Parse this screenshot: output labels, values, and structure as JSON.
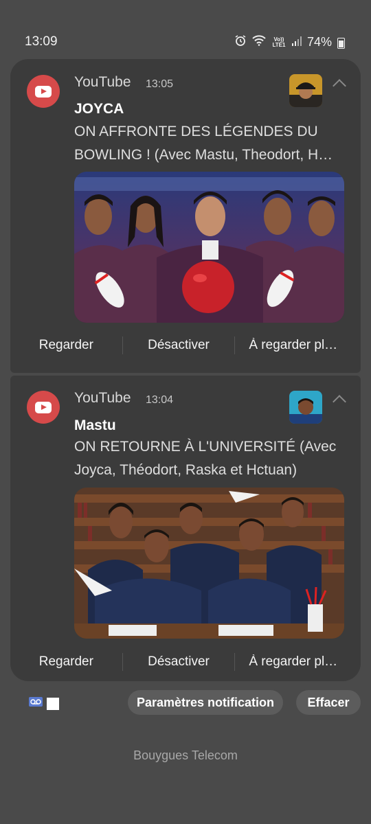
{
  "status_bar": {
    "time": "13:09",
    "network": "Vo)) LTE1",
    "battery": "74%"
  },
  "notifications": [
    {
      "app": "YouTube",
      "time": "13:05",
      "sender": "JOYCA",
      "text": "ON AFFRONTE DES LÉGENDES DU BOWLING ! (Avec Mastu, Theodort, H…",
      "actions": [
        "Regarder",
        "Désactiver",
        "À regarder pl…"
      ]
    },
    {
      "app": "YouTube",
      "time": "13:04",
      "sender": "Mastu",
      "text": "ON RETOURNE À L'UNIVERSITÉ (Avec Joyca, Théodort, Raska et Hctuan)",
      "actions": [
        "Regarder",
        "Désactiver",
        "À regarder pl…"
      ]
    }
  ],
  "footer": {
    "settings_label": "Paramètres notification",
    "clear_label": "Effacer",
    "carrier": "Bouygues Telecom"
  },
  "colors": {
    "background": "#4a4a4a",
    "card": "#3b3b3b",
    "app_icon": "#d64a4a"
  }
}
